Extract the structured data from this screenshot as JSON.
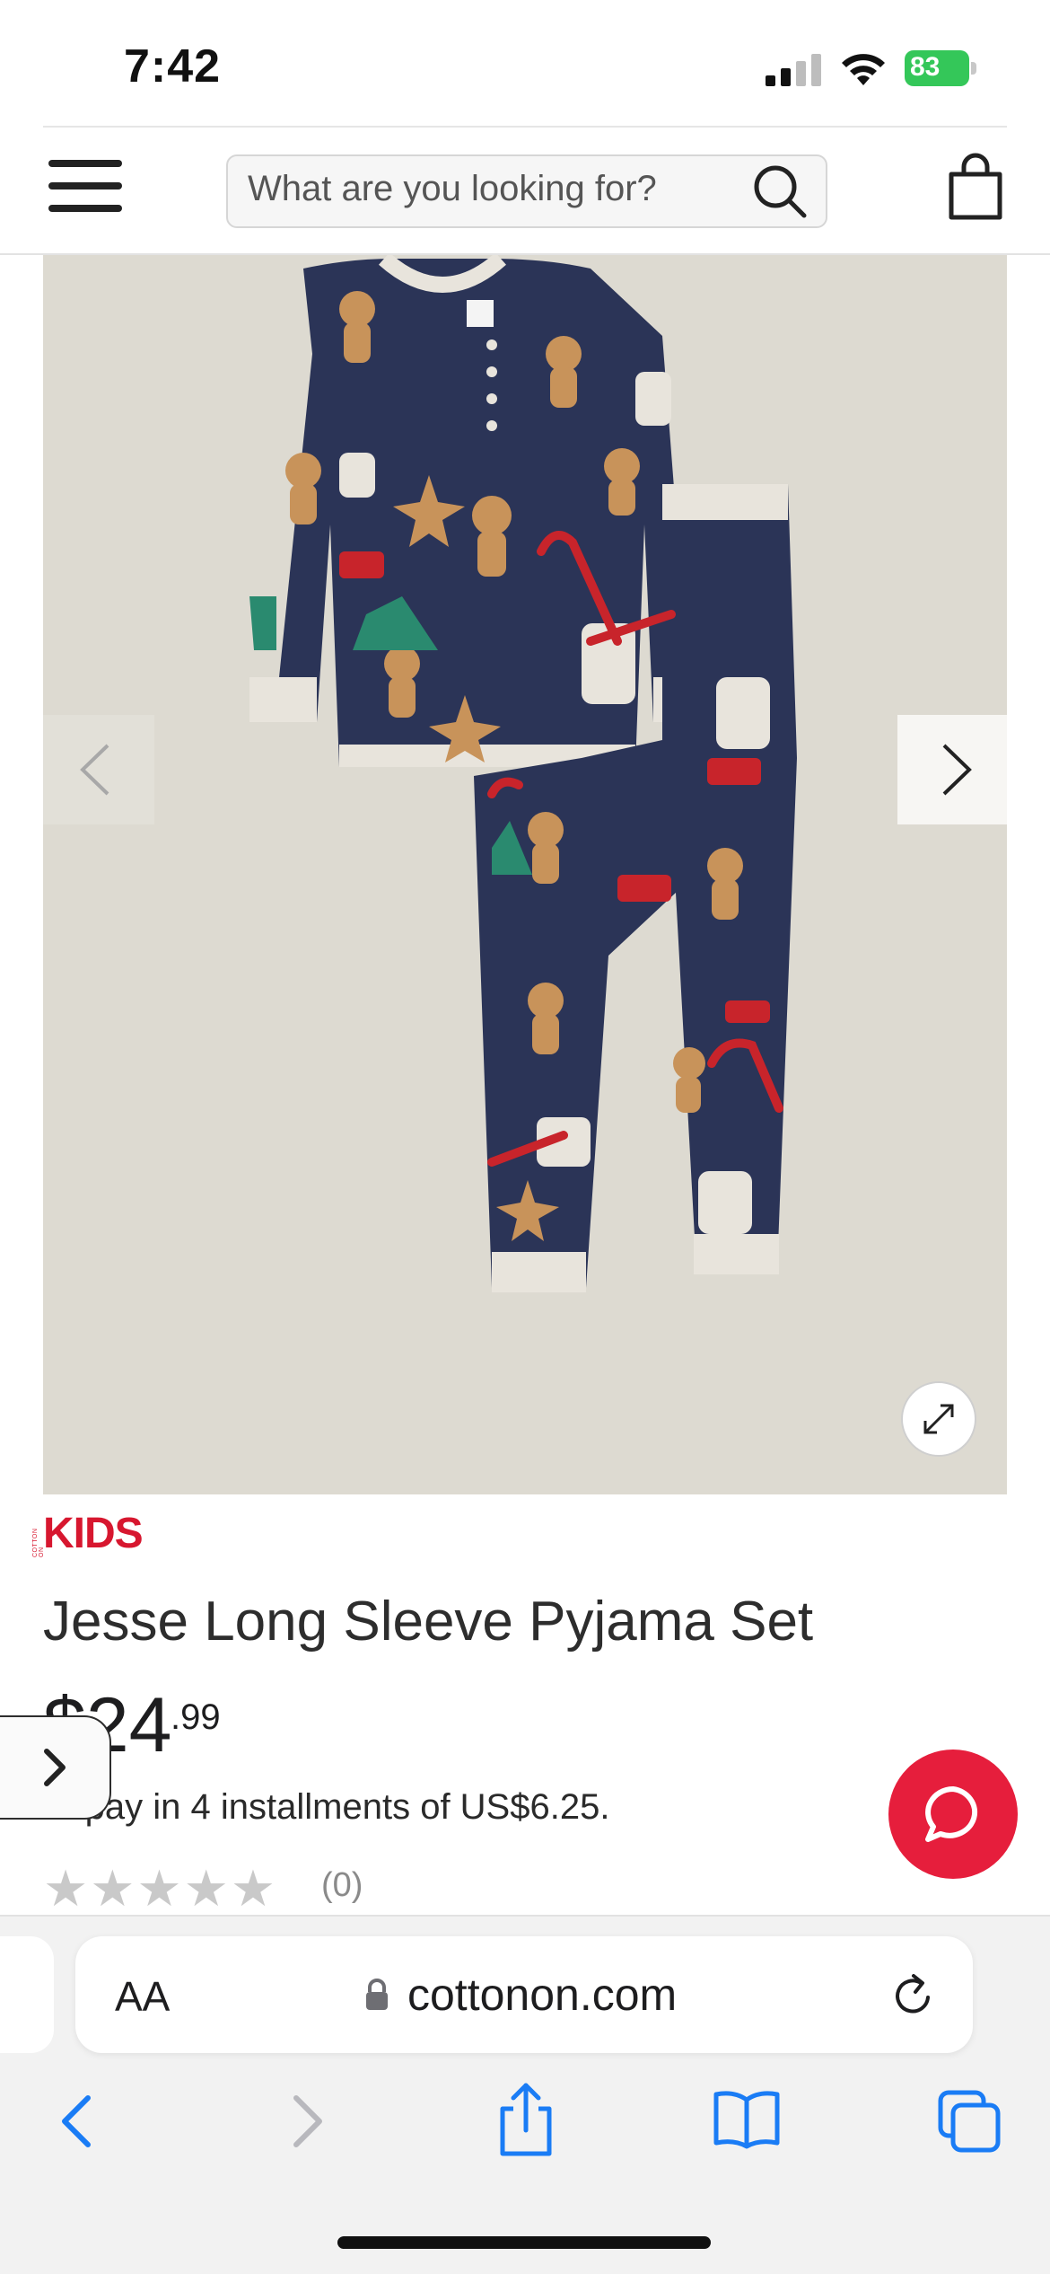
{
  "status_bar": {
    "time": "7:42",
    "battery": "83"
  },
  "header": {
    "search_placeholder": "What are you looking for?"
  },
  "product": {
    "brand": "KIDS",
    "brand_small": "COTTON ON",
    "title": "Jesse Long Sleeve Pyjama Set",
    "price_main": "$24",
    "price_cents": ".99",
    "installments": "or pay in 4 installments of US$6.25.",
    "rating_stars": "★★★★★",
    "review_count": "(0)",
    "image_background": "#dddad1",
    "print_colors": {
      "navy": "#2b3457",
      "gingerbread": "#c8935a",
      "trim": "#e8e4dc",
      "red": "#c8242b",
      "green": "#2a8a6f"
    }
  },
  "browser": {
    "aa_label": "AA",
    "url": "cottonon.com"
  },
  "colors": {
    "accent_red": "#e61e3c",
    "brand_red": "#d7172f",
    "link_blue": "#1a7cf5"
  },
  "icons": [
    "signal-icon",
    "wifi-icon",
    "battery-icon",
    "menu-icon",
    "search-icon",
    "bag-icon",
    "chevron-left-icon",
    "chevron-right-icon",
    "expand-icon",
    "chat-icon",
    "lock-icon",
    "reload-icon",
    "back-icon",
    "forward-icon",
    "share-icon",
    "bookmarks-icon",
    "tabs-icon"
  ]
}
